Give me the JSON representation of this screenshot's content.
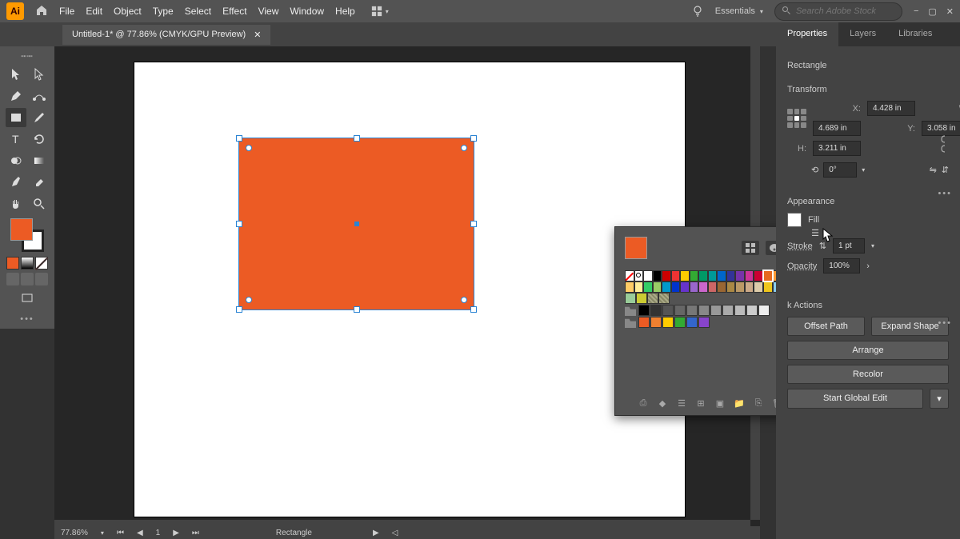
{
  "menubar": {
    "items": [
      "File",
      "Edit",
      "Object",
      "Type",
      "Select",
      "Effect",
      "View",
      "Window",
      "Help"
    ],
    "workspace": "Essentials",
    "search_placeholder": "Search Adobe Stock"
  },
  "tab": {
    "title": "Untitled-1* @ 77.86% (CMYK/GPU Preview)"
  },
  "status": {
    "zoom": "77.86%",
    "artboard": "1",
    "tool": "Rectangle"
  },
  "properties": {
    "tabs": [
      "Properties",
      "Layers",
      "Libraries"
    ],
    "object_type": "Rectangle",
    "transform_label": "Transform",
    "x": "4.428 in",
    "y": "3.058 in",
    "w": "4.689 in",
    "h": "3.211 in",
    "rotation": "0°",
    "appearance_label": "Appearance",
    "fill_label": "Fill",
    "stroke_label": "Stroke",
    "stroke_weight": "1 pt",
    "opacity_label": "Opacity",
    "opacity_value": "100%",
    "quick_actions_label": "k Actions",
    "offset_path": "Offset Path",
    "expand_shape": "Expand Shape",
    "arrange": "Arrange",
    "recolor": "Recolor",
    "start_global_edit": "Start Global Edit"
  },
  "swatches": {
    "rows": [
      [
        "none",
        "reg",
        "#ffffff",
        "#000000",
        "#cc0000",
        "#ee3333",
        "#ffcc00",
        "#33aa33",
        "#009966",
        "#009999",
        "#0066cc",
        "#333399",
        "#7733aa",
        "#cc3399",
        "#cc0033",
        "#e66a1f",
        "#ff9933"
      ],
      [
        "#ffcc66",
        "#ffee99",
        "#33cc66",
        "#99cc66",
        "#0099cc",
        "#0033cc",
        "#6633cc",
        "#9966cc",
        "#cc66cc",
        "#cc6666",
        "#996633",
        "#aa8844",
        "#bb9966",
        "#ccaa88",
        "#ddccaa",
        "#efc61c",
        "#88ccee"
      ],
      [
        "#99cc99",
        "#cccc33",
        "pat1",
        "pat2"
      ],
      [
        "folder",
        "#000000",
        "#333333",
        "#555555",
        "#666666",
        "#777777",
        "#888888",
        "#999999",
        "#aaaaaa",
        "#bbbbbb",
        "#cccccc",
        "#eeeeee"
      ],
      [
        "folder",
        "#ec5b24",
        "#f08030",
        "#ffcc00",
        "#33aa33",
        "#3366cc",
        "#8844cc"
      ]
    ],
    "selected": "#e66a1f"
  },
  "colors": {
    "rect_fill": "#ec5b24"
  }
}
